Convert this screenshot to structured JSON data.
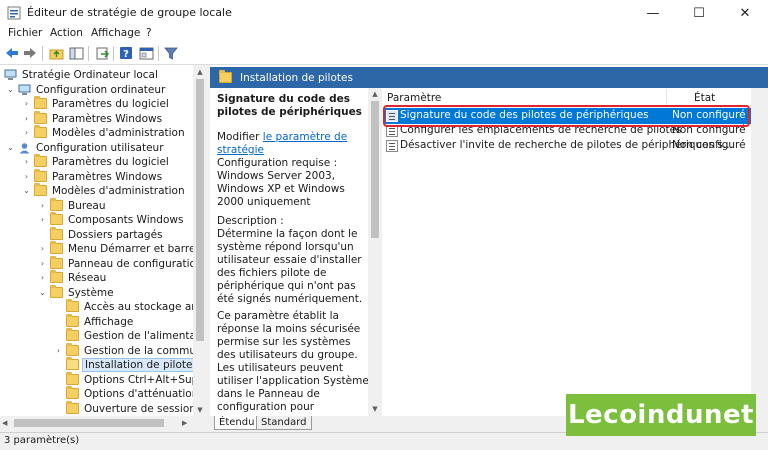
{
  "window": {
    "title": "Éditeur de stratégie de groupe locale",
    "minimize": "—",
    "maximize": "☐",
    "close": "✕"
  },
  "menu": [
    "Fichier",
    "Action",
    "Affichage",
    "?"
  ],
  "toolbar": {
    "icons": [
      "back-icon",
      "forward-icon",
      "folder-up-icon",
      "show-hide-tree-icon",
      "export-icon",
      "help-icon",
      "properties-icon",
      "filter-icon"
    ]
  },
  "tree": {
    "items": [
      {
        "label": "Stratégie Ordinateur local",
        "level": 0,
        "expander": "",
        "icon": "computer"
      },
      {
        "label": "Configuration ordinateur",
        "level": 1,
        "expander": "open",
        "icon": "computer"
      },
      {
        "label": "Paramètres du logiciel",
        "level": 2,
        "expander": "closed",
        "icon": "folder"
      },
      {
        "label": "Paramètres Windows",
        "level": 2,
        "expander": "closed",
        "icon": "folder"
      },
      {
        "label": "Modèles d'administration",
        "level": 2,
        "expander": "closed",
        "icon": "folder"
      },
      {
        "label": "Configuration utilisateur",
        "level": 1,
        "expander": "open",
        "icon": "user"
      },
      {
        "label": "Paramètres du logiciel",
        "level": 2,
        "expander": "closed",
        "icon": "folder"
      },
      {
        "label": "Paramètres Windows",
        "level": 2,
        "expander": "closed",
        "icon": "folder"
      },
      {
        "label": "Modèles d'administration",
        "level": 2,
        "expander": "open",
        "icon": "folder"
      },
      {
        "label": "Bureau",
        "level": 3,
        "expander": "closed",
        "icon": "folder"
      },
      {
        "label": "Composants Windows",
        "level": 3,
        "expander": "closed",
        "icon": "folder"
      },
      {
        "label": "Dossiers partagés",
        "level": 3,
        "expander": "",
        "icon": "folder"
      },
      {
        "label": "Menu Démarrer et barre des tâches",
        "level": 3,
        "expander": "closed",
        "icon": "folder"
      },
      {
        "label": "Panneau de configuration",
        "level": 3,
        "expander": "closed",
        "icon": "folder"
      },
      {
        "label": "Réseau",
        "level": 3,
        "expander": "closed",
        "icon": "folder"
      },
      {
        "label": "Système",
        "level": 3,
        "expander": "open",
        "icon": "folder"
      },
      {
        "label": "Accès au stockage amovible",
        "level": 4,
        "expander": "",
        "icon": "folder"
      },
      {
        "label": "Affichage",
        "level": 4,
        "expander": "",
        "icon": "folder"
      },
      {
        "label": "Gestion de l'alimentation",
        "level": 4,
        "expander": "",
        "icon": "folder"
      },
      {
        "label": "Gestion de la communication Internet",
        "level": 4,
        "expander": "closed",
        "icon": "folder"
      },
      {
        "label": "Installation de pilotes",
        "level": 4,
        "expander": "",
        "icon": "folder-open",
        "selected": true
      },
      {
        "label": "Options Ctrl+Alt+Suppr",
        "level": 4,
        "expander": "",
        "icon": "folder"
      },
      {
        "label": "Options d'atténuation",
        "level": 4,
        "expander": "",
        "icon": "folder"
      },
      {
        "label": "Ouverture de session",
        "level": 4,
        "expander": "",
        "icon": "folder"
      }
    ]
  },
  "right": {
    "header": "Installation de pilotes",
    "description": {
      "title": "Signature du code des pilotes de périphériques",
      "modify_prefix": "Modifier ",
      "modify_link": "le paramètre de stratégie",
      "requirements": "Configuration requise :\nWindows Server 2003, Windows XP et Windows 2000 uniquement",
      "description_label": "Description :",
      "description_text": "Détermine la façon dont le système répond lorsqu'un utilisateur essaie d'installer des fichiers pilote de périphérique qui n'ont pas été signés numériquement.",
      "paragraph2": "Ce paramètre établit la réponse la moins sécurisée permise sur les systèmes des utilisateurs du groupe. Les utilisateurs peuvent utiliser l'application Système dans le Panneau de configuration pour sélectionner un paramètre plus sécurisé, mais lorsque ce paramètre est activé, le système"
    },
    "columns": {
      "name": "Paramètre",
      "state": "État"
    },
    "rows": [
      {
        "name": "Signature du code des pilotes de périphériques",
        "state": "Non configuré",
        "selected": true
      },
      {
        "name": "Configurer les emplacements de recherche de pilotes",
        "state": "Non configuré"
      },
      {
        "name": "Désactiver l'invite de recherche de pilotes de périphériques s...",
        "state": "Non configuré"
      }
    ],
    "tabs": [
      "Étendu",
      "Standard"
    ]
  },
  "status": "3 paramètre(s)",
  "watermark": "Lecoindunet"
}
